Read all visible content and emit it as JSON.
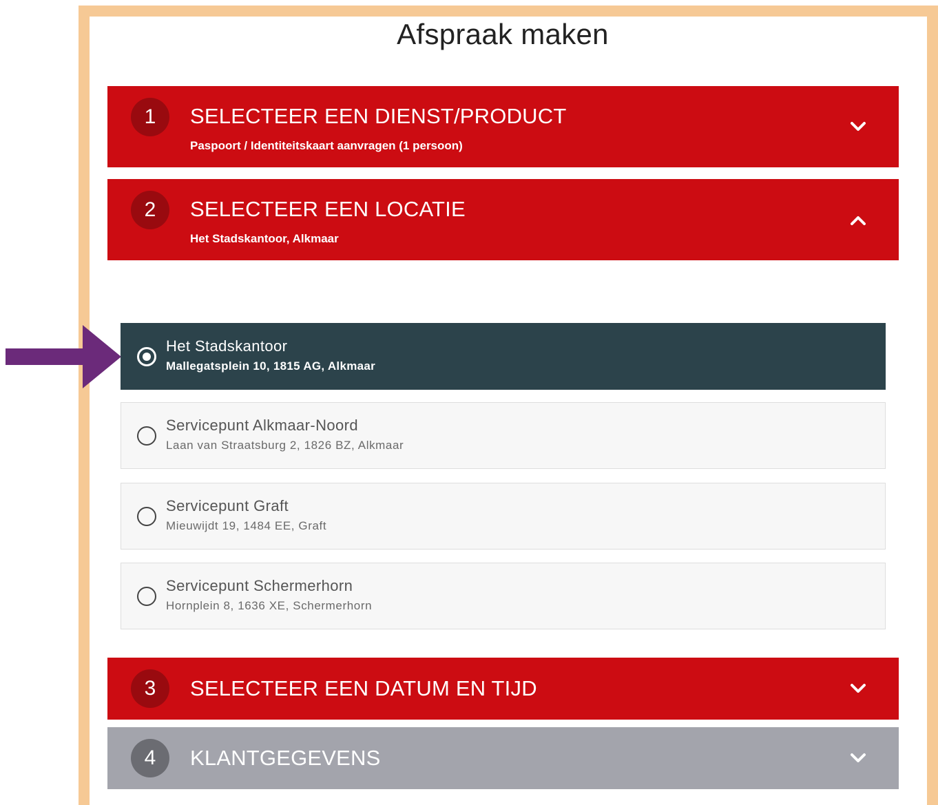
{
  "page": {
    "title": "Afspraak maken"
  },
  "steps": [
    {
      "number": "1",
      "title": "SELECTEER EEN DIENST/PRODUCT",
      "subtitle": "Paspoort / Identiteitskaart aanvragen (1 persoon)",
      "state": "collapsed",
      "color": "#cc0c12"
    },
    {
      "number": "2",
      "title": "SELECTEER EEN LOCATIE",
      "subtitle": "Het Stadskantoor, Alkmaar",
      "state": "expanded",
      "color": "#cc0c12"
    },
    {
      "number": "3",
      "title": "SELECTEER EEN DATUM EN TIJD",
      "subtitle": "",
      "state": "collapsed",
      "color": "#cc0c12"
    },
    {
      "number": "4",
      "title": "KLANTGEGEVENS",
      "subtitle": "",
      "state": "collapsed",
      "color": "#a3a4ac"
    }
  ],
  "locations": [
    {
      "name": "Het Stadskantoor",
      "address": "Mallegatsplein 10, 1815 AG, Alkmaar",
      "selected": true
    },
    {
      "name": "Servicepunt Alkmaar-Noord",
      "address": "Laan van Straatsburg 2, 1826 BZ, Alkmaar",
      "selected": false
    },
    {
      "name": "Servicepunt Graft",
      "address": "Mieuwijdt 19, 1484 EE, Graft",
      "selected": false
    },
    {
      "name": "Servicepunt Schermerhorn",
      "address": "Hornplein 8, 1636 XE, Schermerhorn",
      "selected": false
    }
  ],
  "colors": {
    "accent_red": "#cc0c12",
    "selected_location": "#2c434b",
    "disabled_step": "#a3a4ac",
    "frame_border": "#f6c995",
    "annotation_arrow": "#6b2a7a"
  },
  "icons": {
    "collapsed": "chevron-down-icon",
    "expanded": "chevron-up-icon",
    "radio_on": "radio-checked-icon",
    "radio_off": "radio-unchecked-icon"
  }
}
